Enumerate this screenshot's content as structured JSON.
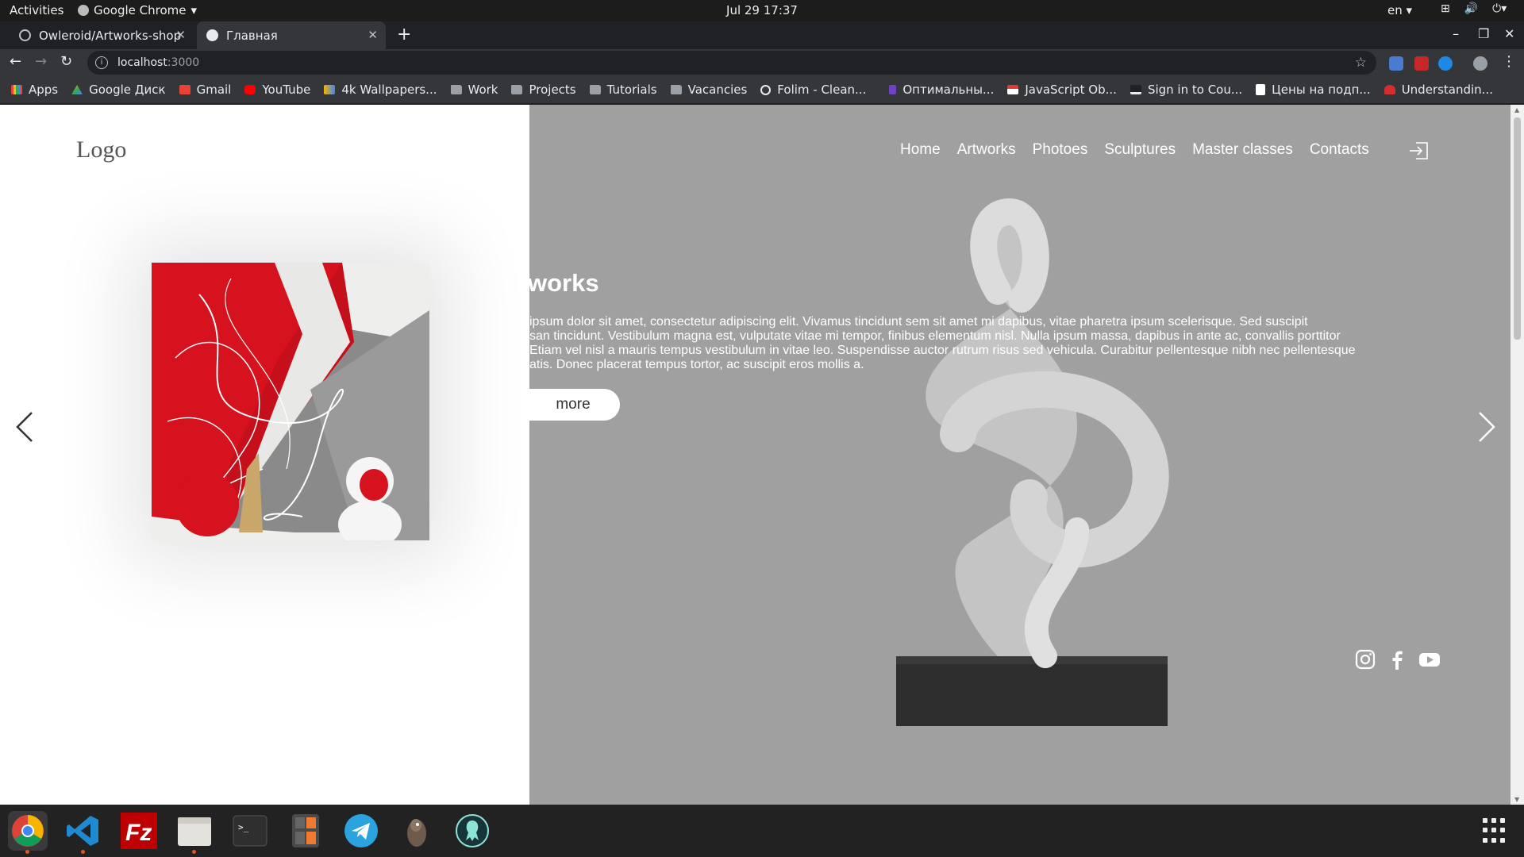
{
  "system_bar": {
    "activities": "Activities",
    "app_name": "Google Chrome",
    "clock": "Jul 29  17:37",
    "language": "en"
  },
  "browser": {
    "tabs": [
      {
        "title": "Owleroid/Artworks-shop",
        "active": false
      },
      {
        "title": "Главная",
        "active": true
      }
    ],
    "url_host": "localhost",
    "url_port": ":3000",
    "bookmarks": [
      {
        "label": "Apps",
        "icon": "apps-grid-icon",
        "color": "#4285f4"
      },
      {
        "label": "Google Диск",
        "icon": "drive-icon",
        "color": "#34a853"
      },
      {
        "label": "Gmail",
        "icon": "gmail-icon",
        "color": "#ea4335"
      },
      {
        "label": "YouTube",
        "icon": "youtube-icon",
        "color": "#ff0000"
      },
      {
        "label": "4k Wallpapers...",
        "icon": "wallpaper-icon",
        "color": "#f4b400"
      },
      {
        "label": "Work",
        "icon": "folder-icon",
        "color": "#9aa0a6"
      },
      {
        "label": "Projects",
        "icon": "folder-icon",
        "color": "#9aa0a6"
      },
      {
        "label": "Tutorials",
        "icon": "folder-icon",
        "color": "#9aa0a6"
      },
      {
        "label": "Vacancies",
        "icon": "folder-icon",
        "color": "#9aa0a6"
      },
      {
        "label": "Folim - Clean...",
        "icon": "globe-icon",
        "color": "#e8eaed"
      },
      {
        "label": "Оптимальны...",
        "icon": "z-icon",
        "color": "#6f42c1"
      },
      {
        "label": "JavaScript Ob...",
        "icon": "js-icon",
        "color": "#e53935"
      },
      {
        "label": "Sign in to Cou...",
        "icon": "coursera-icon",
        "color": "#e8eaed"
      },
      {
        "label": "Цены на подп...",
        "icon": "h-icon",
        "color": "#ffffff"
      },
      {
        "label": "Understandin...",
        "icon": "u-icon",
        "color": "#d32f2f"
      }
    ]
  },
  "site": {
    "logo": "Logo",
    "nav": [
      "Home",
      "Artworks",
      "Photoes",
      "Sculptures",
      "Master classes",
      "Contacts"
    ],
    "hero": {
      "title": "works",
      "text": " ipsum dolor sit amet, consectetur adipiscing elit. Vivamus tincidunt sem sit amet mi dapibus, vitae pharetra ipsum scelerisque. Sed suscipit\nsan tincidunt. Vestibulum magna est, vulputate vitae mi tempor, finibus elementum nisl. Nulla ipsum massa, dapibus in ante ac, convallis porttitor\n Etiam vel nisl a mauris tempus vestibulum in vitae leo. Suspendisse auctor rutrum risus sed vehicula. Curabitur pellentesque nibh nec pellentesque\natis. Donec placerat tempus tortor, ac suscipit eros mollis a.",
      "button": "more"
    },
    "social": [
      "instagram-icon",
      "facebook-icon",
      "youtube-icon"
    ],
    "colors": {
      "right_overlay": "#a0a0a0",
      "accent_red": "#d6121e"
    }
  },
  "dock": {
    "apps": [
      "chrome-icon",
      "vscode-icon",
      "filezilla-icon",
      "files-icon",
      "terminal-icon",
      "calculator-icon",
      "telegram-icon",
      "gimp-icon",
      "gitkraken-icon"
    ]
  }
}
